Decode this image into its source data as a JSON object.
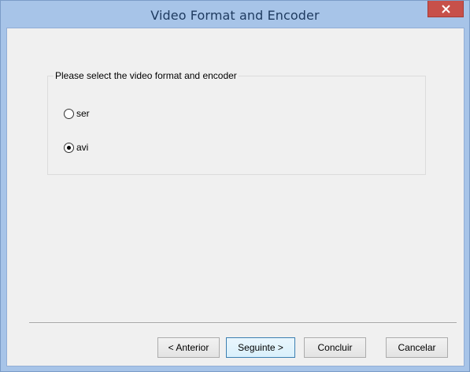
{
  "window": {
    "title": "Video Format and Encoder",
    "close_icon": "close-icon"
  },
  "group": {
    "legend": "Please select the video format and encoder",
    "options": [
      {
        "label": "ser",
        "checked": false
      },
      {
        "label": "avi",
        "checked": true
      }
    ]
  },
  "buttons": {
    "back": "< Anterior",
    "next": "Seguinte >",
    "finish": "Concluir",
    "cancel": "Cancelar"
  },
  "colors": {
    "titlebar": "#a7c4e8",
    "close_button": "#c7504a",
    "client_background": "#f0f0f0",
    "default_button_border": "#3c7fb1"
  }
}
